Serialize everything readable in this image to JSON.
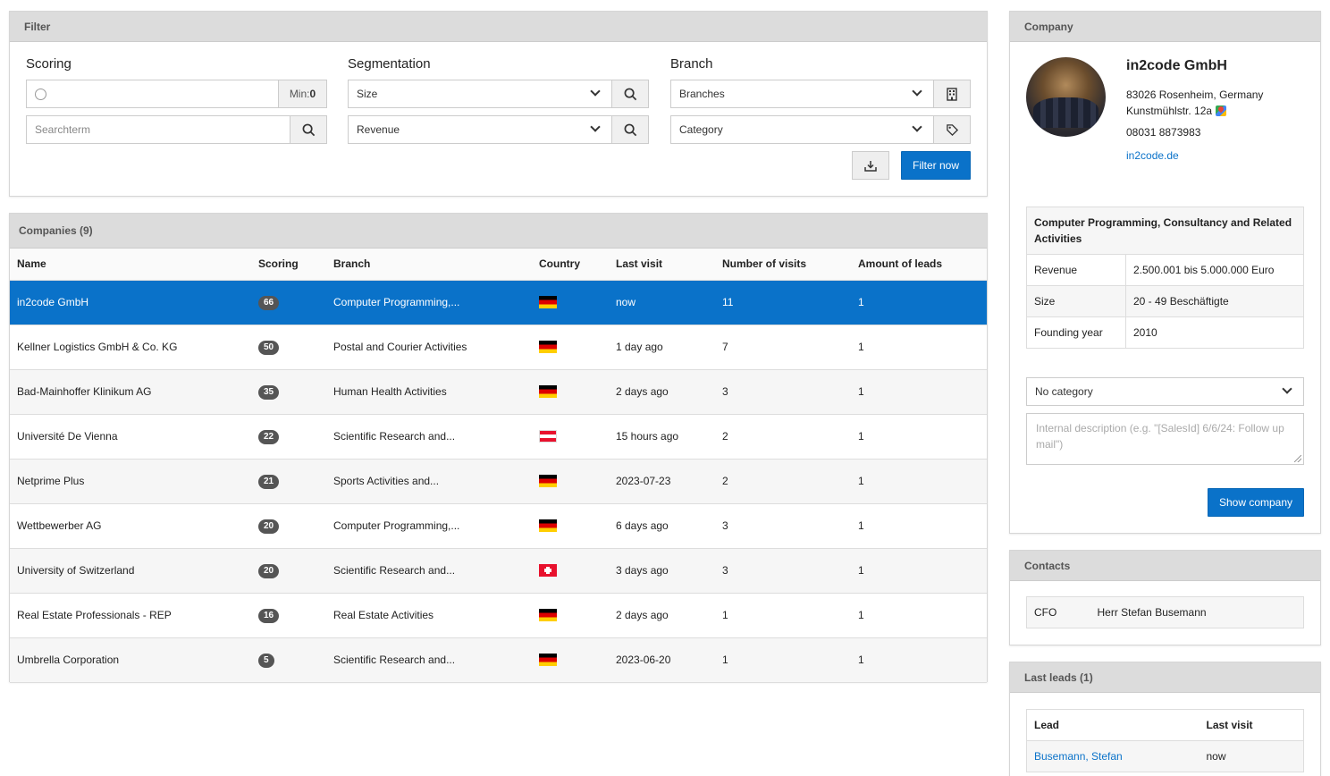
{
  "filter": {
    "title": "Filter",
    "scoring": {
      "label": "Scoring",
      "min_label": "Min:",
      "min_value": "0"
    },
    "searchterm_placeholder": "Searchterm",
    "segmentation": {
      "label": "Segmentation",
      "size": "Size",
      "revenue": "Revenue"
    },
    "branch": {
      "label": "Branch",
      "branches": "Branches",
      "category": "Category"
    },
    "filter_button": "Filter now"
  },
  "companies": {
    "title": "Companies (9)",
    "columns": [
      "Name",
      "Scoring",
      "Branch",
      "Country",
      "Last visit",
      "Number of visits",
      "Amount of leads"
    ],
    "rows": [
      {
        "name": "in2code GmbH",
        "scoring": "66",
        "branch": "Computer Programming,...",
        "country": "de",
        "last_visit": "now",
        "visits": "11",
        "leads": "1",
        "selected": true
      },
      {
        "name": "Kellner Logistics GmbH & Co. KG",
        "scoring": "50",
        "branch": "Postal and Courier Activities",
        "country": "de",
        "last_visit": "1 day ago",
        "visits": "7",
        "leads": "1"
      },
      {
        "name": "Bad-Mainhoffer Klinikum AG",
        "scoring": "35",
        "branch": "Human Health Activities",
        "country": "de",
        "last_visit": "2 days ago",
        "visits": "3",
        "leads": "1"
      },
      {
        "name": "Université De Vienna",
        "scoring": "22",
        "branch": "Scientific Research and...",
        "country": "at",
        "last_visit": "15 hours ago",
        "visits": "2",
        "leads": "1"
      },
      {
        "name": "Netprime Plus",
        "scoring": "21",
        "branch": "Sports Activities and...",
        "country": "de",
        "last_visit": "2023-07-23",
        "visits": "2",
        "leads": "1"
      },
      {
        "name": "Wettbewerber AG",
        "scoring": "20",
        "branch": "Computer Programming,...",
        "country": "de",
        "last_visit": "6 days ago",
        "visits": "3",
        "leads": "1"
      },
      {
        "name": "University of Switzerland",
        "scoring": "20",
        "branch": "Scientific Research and...",
        "country": "ch",
        "last_visit": "3 days ago",
        "visits": "3",
        "leads": "1"
      },
      {
        "name": "Real Estate Professionals - REP",
        "scoring": "16",
        "branch": "Real Estate Activities",
        "country": "de",
        "last_visit": "2 days ago",
        "visits": "1",
        "leads": "1"
      },
      {
        "name": "Umbrella Corporation",
        "scoring": "5",
        "branch": "Scientific Research and...",
        "country": "de",
        "last_visit": "2023-06-20",
        "visits": "1",
        "leads": "1"
      }
    ]
  },
  "company": {
    "title": "Company",
    "name": "in2code GmbH",
    "address_line1": "83026 Rosenheim, Germany",
    "address_line2": "Kunstmühlstr. 12a",
    "phone": "08031 8873983",
    "website": "in2code.de",
    "details": {
      "branch": "Computer Programming, Consultancy and Related Activities",
      "revenue_label": "Revenue",
      "revenue": "2.500.001 bis 5.000.000 Euro",
      "size_label": "Size",
      "size": "20 - 49 Beschäftigte",
      "founding_label": "Founding year",
      "founding": "2010"
    },
    "category_select": "No category",
    "description_placeholder": "Internal description (e.g. \"[SalesId] 6/6/24: Follow up mail\")",
    "show_button": "Show company"
  },
  "contacts": {
    "title": "Contacts",
    "items": [
      {
        "role": "CFO",
        "name": "Herr Stefan Busemann"
      }
    ]
  },
  "leads": {
    "title": "Last leads (1)",
    "columns": [
      "Lead",
      "Last visit"
    ],
    "items": [
      {
        "lead": "Busemann, Stefan",
        "last_visit": "now"
      }
    ]
  },
  "colors": {
    "accent": "#0a72c9",
    "header": "#dcdcdc",
    "badge": "#555555"
  }
}
